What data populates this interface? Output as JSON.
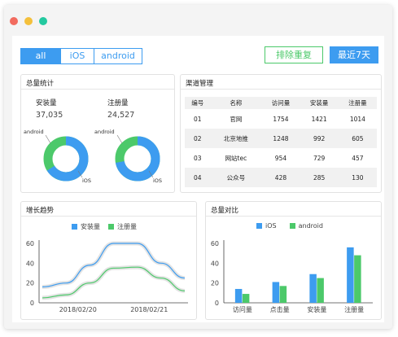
{
  "window": {
    "dots": [
      "#f26b5f",
      "#f4c03b",
      "#23c9a0"
    ]
  },
  "filter": {
    "tabs": [
      "all",
      "iOS",
      "android"
    ],
    "active": "all"
  },
  "actions": {
    "dedupe_label": "排除重复",
    "range_label": "最近7天"
  },
  "stats": {
    "title": "总量统计",
    "install_label": "安装量",
    "install_value": "37,035",
    "register_label": "注册量",
    "register_value": "24,527",
    "label_android": "android",
    "label_ios": "iOS",
    "donut_install": {
      "ios": 0.66,
      "android": 0.34
    },
    "donut_register": {
      "ios": 0.72,
      "android": 0.28
    }
  },
  "channels": {
    "title": "渠道管理",
    "headers": [
      "编号",
      "名称",
      "访问量",
      "安装量",
      "注册量"
    ],
    "rows": [
      [
        "01",
        "官网",
        "1754",
        "1421",
        "1014"
      ],
      [
        "02",
        "北京地推",
        "1248",
        "992",
        "605"
      ],
      [
        "03",
        "网站tec",
        "954",
        "729",
        "457"
      ],
      [
        "04",
        "公众号",
        "428",
        "285",
        "130"
      ]
    ]
  },
  "colors": {
    "ios": "#3d9cf0",
    "android": "#4cc96a"
  },
  "trend": {
    "title": "增长趋势",
    "legend": [
      "安装量",
      "注册量"
    ],
    "chart_data": {
      "type": "line",
      "x": [
        "",
        "2018/02/20",
        "",
        "2018/02/21",
        ""
      ],
      "series": [
        {
          "name": "安装量",
          "values": [
            16,
            20,
            38,
            60,
            60,
            40,
            25
          ]
        },
        {
          "name": "注册量",
          "values": [
            5,
            8,
            20,
            35,
            36,
            25,
            12
          ]
        }
      ],
      "yticks": [
        "0",
        "20",
        "40",
        "60"
      ],
      "ylim": [
        0,
        60
      ]
    }
  },
  "compare": {
    "title": "总量对比",
    "legend": [
      "iOS",
      "android"
    ],
    "chart_data": {
      "type": "bar",
      "categories": [
        "访问量",
        "点击量",
        "安装量",
        "注册量"
      ],
      "series": [
        {
          "name": "iOS",
          "values": [
            14,
            21,
            29,
            56
          ]
        },
        {
          "name": "android",
          "values": [
            9,
            17,
            25,
            48
          ]
        }
      ],
      "yticks": [
        "0",
        "20",
        "40",
        "60"
      ],
      "ylim": [
        0,
        60
      ]
    }
  }
}
